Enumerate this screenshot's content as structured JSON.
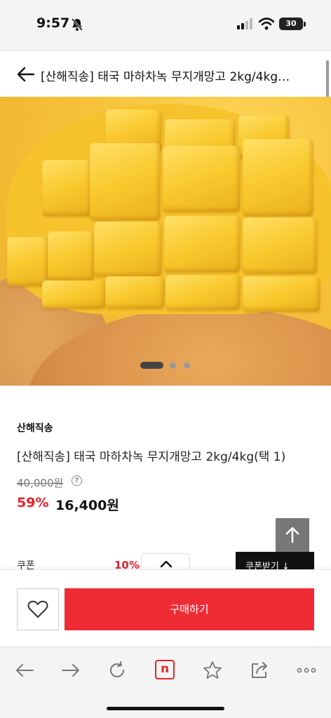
{
  "status_bar": {
    "time": "9:57",
    "battery": "30",
    "icons": [
      "bell-slash-icon",
      "signal-icon",
      "wifi-icon",
      "battery-icon"
    ]
  },
  "header": {
    "title": "[산해직송] 태국 마하차녹 무지개망고 2kg/4kg(택 1)",
    "back_icon": "arrow-left-icon"
  },
  "gallery": {
    "image_subject": "cubed mango",
    "slide_count": 3,
    "active_slide": 1
  },
  "product": {
    "brand": "산해직송",
    "title": "[산해직송] 태국 마하차녹 무지개망고 2kg/4kg(택 1)",
    "original_price": "40,000원",
    "info_icon": "?",
    "discount_rate": "59%",
    "sale_price": "16,400원"
  },
  "coupon": {
    "label": "쿠폰",
    "rate": "10%",
    "button_label": "쿠폰받기 ↓"
  },
  "buy_bar": {
    "wish_icon": "heart-icon",
    "buy_label": "구매하기"
  },
  "browser_bar": {
    "icons": [
      "back-arrow-icon",
      "forward-arrow-icon",
      "reload-icon",
      "naver-home-icon",
      "bookmark-star-icon",
      "share-icon",
      "more-icon"
    ],
    "naver_label": "n"
  },
  "colors": {
    "accent_red": "#ef2c35",
    "discount_red": "#e8222a",
    "dark": "#111111"
  }
}
